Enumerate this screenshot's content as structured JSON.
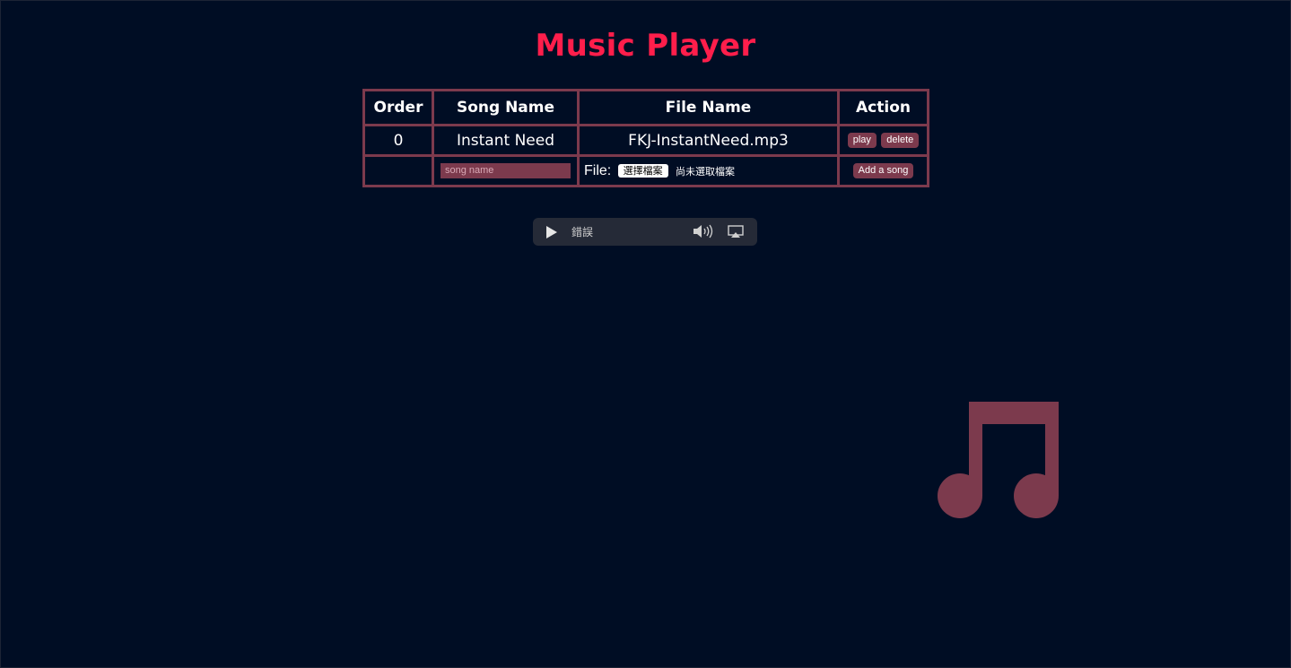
{
  "title": "Music Player",
  "table": {
    "headers": [
      "Order",
      "Song Name",
      "File Name",
      "Action"
    ],
    "rows": [
      {
        "order": "0",
        "song_name": "Instant Need",
        "file_name": "FKJ-InstantNeed.mp3",
        "play_label": "play",
        "delete_label": "delete"
      }
    ],
    "new_song": {
      "name_placeholder": "song name",
      "file_label": "File:",
      "choose_file_label": "選擇檔案",
      "no_file_label": "尚未選取檔案",
      "add_label": "Add a song"
    }
  },
  "audio": {
    "status": "錯誤"
  },
  "colors": {
    "background": "#000d24",
    "title": "#ff1e4b",
    "accent": "#7c3a4d"
  },
  "icons": {
    "play": "play-icon",
    "volume": "volume-icon",
    "airplay": "airplay-icon",
    "decoration": "music-note-icon"
  }
}
